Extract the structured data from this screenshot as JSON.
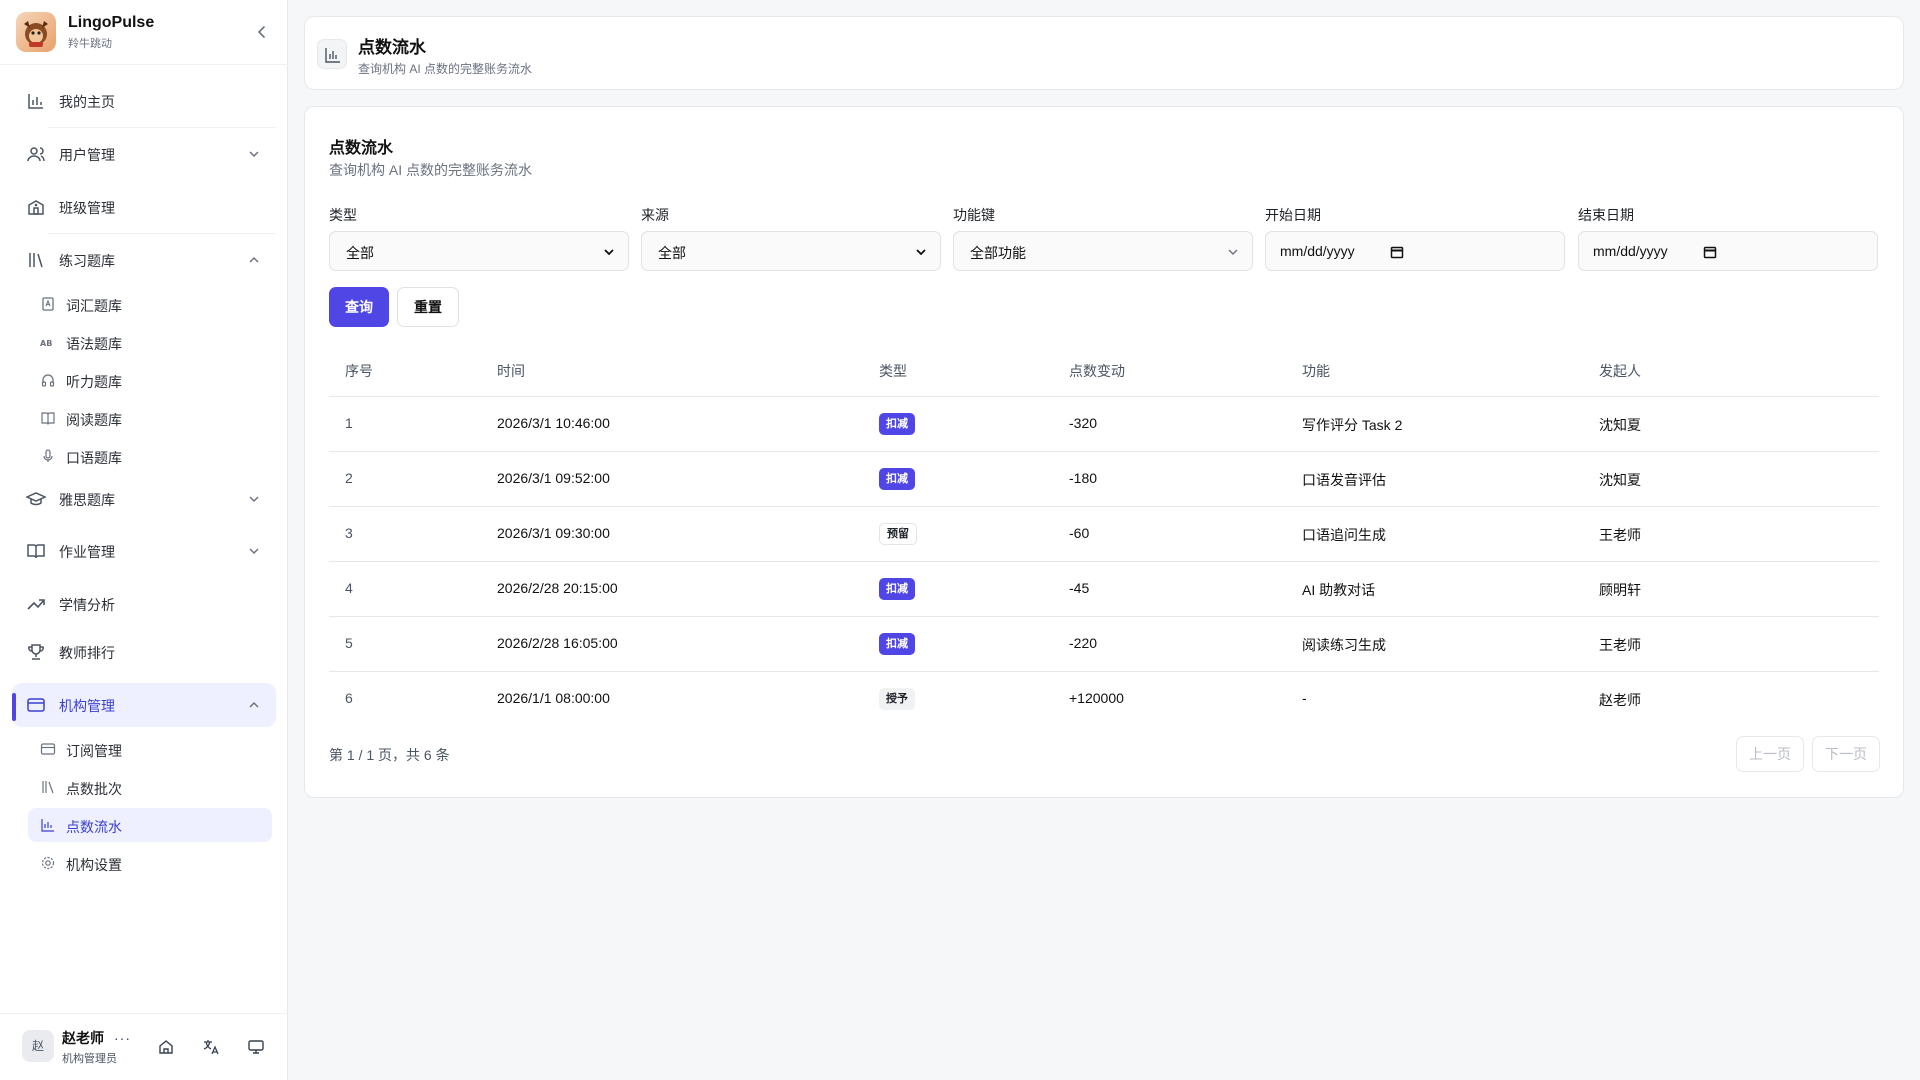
{
  "app": {
    "name": "LingoPulse",
    "subtitle": "羚牛跳动"
  },
  "sidebar": {
    "items": [
      {
        "label": "我的主页",
        "icon": "bar-chart-icon"
      },
      {
        "label": "用户管理",
        "icon": "users-icon"
      },
      {
        "label": "班级管理",
        "icon": "school-icon"
      },
      {
        "label": "练习题库",
        "icon": "library-icon"
      },
      {
        "label": "雅思题库",
        "icon": "graduation-cap-icon"
      },
      {
        "label": "作业管理",
        "icon": "book-open-icon"
      },
      {
        "label": "学情分析",
        "icon": "trending-up-icon"
      },
      {
        "label": "教师排行",
        "icon": "trophy-icon"
      },
      {
        "label": "机构管理",
        "icon": "credit-card-icon"
      }
    ],
    "practice_sub": [
      {
        "label": "词汇题库",
        "icon": "vocabulary-icon"
      },
      {
        "label": "语法题库",
        "icon": "grammar-icon"
      },
      {
        "label": "听力题库",
        "icon": "headphones-icon"
      },
      {
        "label": "阅读题库",
        "icon": "book-icon"
      },
      {
        "label": "口语题库",
        "icon": "microphone-icon"
      }
    ],
    "org_sub": [
      {
        "label": "订阅管理",
        "icon": "credit-card-icon"
      },
      {
        "label": "点数批次",
        "icon": "library-icon"
      },
      {
        "label": "点数流水",
        "icon": "bar-chart-icon"
      },
      {
        "label": "机构设置",
        "icon": "gear-icon"
      }
    ],
    "user": {
      "avatar": "赵",
      "name": "赵老师",
      "role": "机构管理员",
      "more": "···"
    }
  },
  "header": {
    "title": "点数流水",
    "subtitle": "查询机构 AI 点数的完整账务流水"
  },
  "panel": {
    "title": "点数流水",
    "subtitle": "查询机构 AI 点数的完整账务流水",
    "filters": {
      "type": {
        "label": "类型",
        "value": "全部"
      },
      "source": {
        "label": "来源",
        "value": "全部"
      },
      "feature": {
        "label": "功能键",
        "value": "全部功能"
      },
      "start": {
        "label": "开始日期",
        "value": "mm/dd/yyyy"
      },
      "end": {
        "label": "结束日期",
        "value": "mm/dd/yyyy"
      }
    },
    "query_label": "查询",
    "reset_label": "重置",
    "columns": [
      "序号",
      "时间",
      "类型",
      "点数变动",
      "功能",
      "发起人"
    ],
    "rows": [
      {
        "idx": "1",
        "time": "2026/3/1 10:46:00",
        "type": "扣减",
        "style": "solid",
        "delta": "-320",
        "feature": "写作评分 Task 2",
        "by": "沈知夏"
      },
      {
        "idx": "2",
        "time": "2026/3/1 09:52:00",
        "type": "扣减",
        "style": "solid",
        "delta": "-180",
        "feature": "口语发音评估",
        "by": "沈知夏"
      },
      {
        "idx": "3",
        "time": "2026/3/1 09:30:00",
        "type": "预留",
        "style": "outline",
        "delta": "-60",
        "feature": "口语追问生成",
        "by": "王老师"
      },
      {
        "idx": "4",
        "time": "2026/2/28 20:15:00",
        "type": "扣减",
        "style": "solid",
        "delta": "-45",
        "feature": "AI 助教对话",
        "by": "顾明轩"
      },
      {
        "idx": "5",
        "time": "2026/2/28 16:05:00",
        "type": "扣减",
        "style": "solid",
        "delta": "-220",
        "feature": "阅读练习生成",
        "by": "王老师"
      },
      {
        "idx": "6",
        "time": "2026/1/1 08:00:00",
        "type": "授予",
        "style": "soft",
        "delta": "+120000",
        "feature": "-",
        "by": "赵老师"
      }
    ],
    "pager": {
      "info": "第 1 / 1 页，共 6 条",
      "prev": "上一页",
      "next": "下一页"
    }
  },
  "colors": {
    "accent": "#4f46e5",
    "active_bg": "#eef0ff"
  }
}
